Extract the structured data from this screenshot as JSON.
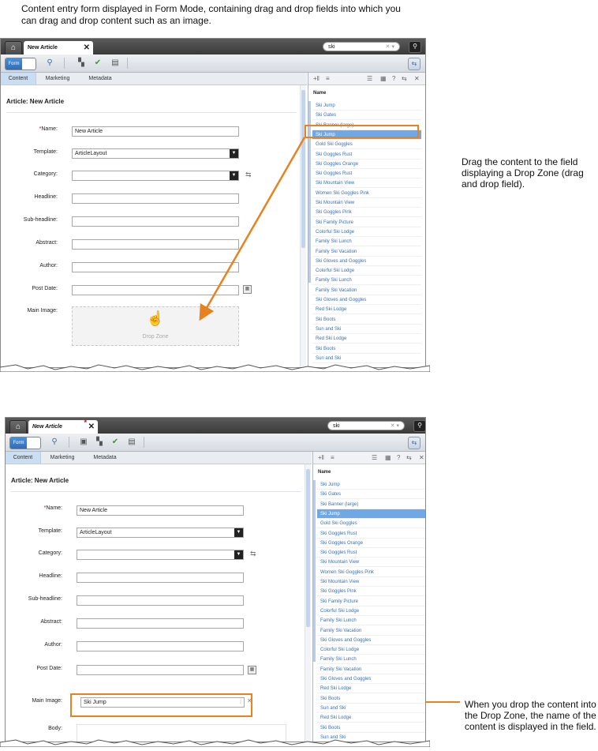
{
  "captions": {
    "intro": "Content entry form displayed in Form Mode, containing drag and drop fields into which you can drag and drop content such as an image.",
    "drag": "Drag the content to the field displaying a Drop Zone (drag and drop field).",
    "drop": "When you drop the content into the Drop Zone, the name of the content is displayed in the field."
  },
  "colors": {
    "highlight": "#e8821e",
    "selected_row": "#6fa8e6",
    "link": "#3a6fb5",
    "titlebar": "#3a3a3a"
  },
  "app": {
    "tab_label": "New Article",
    "search_value": "ski",
    "mode_label": "Form",
    "form_tabs": [
      "Content",
      "Marketing",
      "Metadata"
    ],
    "article_title": "Article: New Article",
    "fields": {
      "name": {
        "label": "Name:",
        "value": "New Article"
      },
      "template": {
        "label": "Template:",
        "value": "ArticleLayout"
      },
      "category": {
        "label": "Category:",
        "value": ""
      },
      "headline": {
        "label": "Headline:",
        "value": ""
      },
      "subheadline": {
        "label": "Sub-headline:",
        "value": ""
      },
      "abstract": {
        "label": "Abstract:",
        "value": ""
      },
      "author": {
        "label": "Author:",
        "value": ""
      },
      "post_date": {
        "label": "Post Date:",
        "value": ""
      },
      "main_image": {
        "label": "Main Image:"
      },
      "body": {
        "label": "Body:"
      }
    },
    "drop_zone_label": "Drop Zone",
    "dropped_value": "Ski Jump",
    "list_header": "Name",
    "list_items": [
      "Ski Jump",
      "Ski Gates",
      "Ski Banner (large)",
      "Ski Jump",
      "Gold Ski Goggles",
      "Ski Goggles Rust",
      "Ski Goggles Orange",
      "Ski Goggles Rust",
      "Ski Mountain View",
      "Women Ski Goggles Pink",
      "Ski Mountain View",
      "Ski Goggles Pink",
      "Ski Family Picture",
      "Colorful Ski Lodge",
      "Family Ski Lunch",
      "Family Ski Vacation",
      "Ski Gloves and Goggles",
      "Colorful Ski Lodge",
      "Family Ski Lunch",
      "Family Ski Vacation",
      "Ski Gloves and Goggles",
      "Red Ski Lodge",
      "Ski Boots",
      "Sun and Ski",
      "Red Ski Lodge",
      "Ski Boots",
      "Sun and Ski"
    ],
    "selected_item": "Ski Jump",
    "icons": [
      "home-icon",
      "close-icon",
      "clear-search-icon",
      "search-icon",
      "binoculars-icon",
      "save-icon",
      "check-icon",
      "trash-icon",
      "sync-icon",
      "calendar-icon",
      "hand-drop-icon",
      "grip-icon"
    ]
  }
}
